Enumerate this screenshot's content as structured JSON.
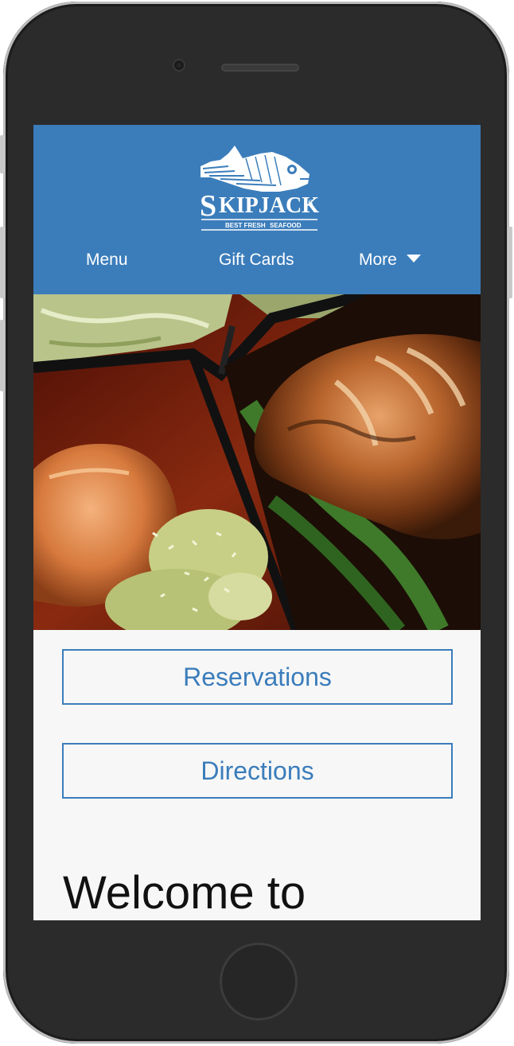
{
  "brand": {
    "name": "SKIPJACK'S",
    "tagline": "BEST FRESH SEAFOOD"
  },
  "nav": {
    "menu_label": "Menu",
    "gift_cards_label": "Gift Cards",
    "more_label": "More"
  },
  "actions": {
    "reservations_label": "Reservations",
    "directions_label": "Directions"
  },
  "content": {
    "welcome_heading": "Welcome to"
  },
  "colors": {
    "brand_blue": "#3b7dbb",
    "page_background": "#f7f7f7",
    "device_body": "#2b2b2b"
  },
  "icons": {
    "more_dropdown": "caret-down-icon"
  }
}
